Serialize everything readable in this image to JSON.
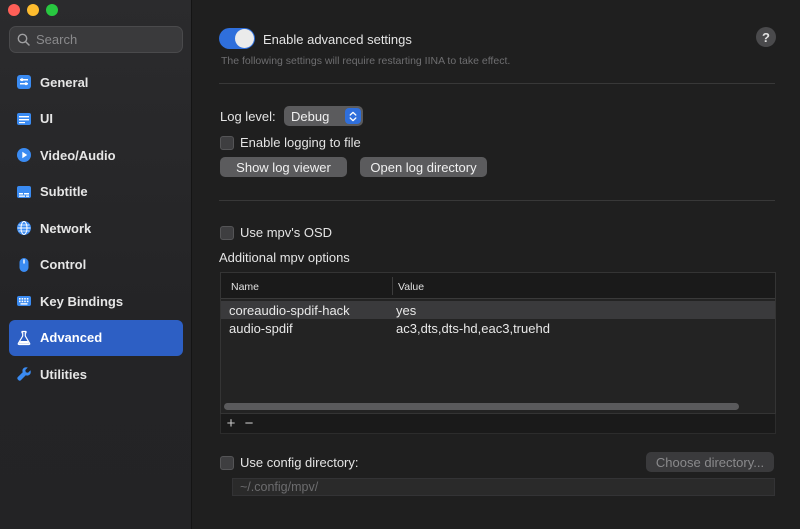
{
  "search": {
    "placeholder": "Search"
  },
  "sidebar": {
    "items": [
      {
        "label": "General",
        "icon": "general-icon"
      },
      {
        "label": "UI",
        "icon": "ui-icon"
      },
      {
        "label": "Video/Audio",
        "icon": "play-icon"
      },
      {
        "label": "Subtitle",
        "icon": "subtitle-icon"
      },
      {
        "label": "Network",
        "icon": "globe-icon"
      },
      {
        "label": "Control",
        "icon": "mouse-icon"
      },
      {
        "label": "Key Bindings",
        "icon": "keyboard-icon"
      },
      {
        "label": "Advanced",
        "icon": "flask-icon",
        "active": true
      },
      {
        "label": "Utilities",
        "icon": "wrench-icon"
      }
    ]
  },
  "advanced": {
    "enable_label": "Enable advanced settings",
    "enabled": true,
    "hint": "The following settings will require restarting IINA to take effect.",
    "help": "?"
  },
  "logging": {
    "level_label": "Log level:",
    "level_value": "Debug",
    "enable_file_label": "Enable logging to file",
    "show_viewer_label": "Show log viewer",
    "open_dir_label": "Open log directory"
  },
  "mpv": {
    "osd_label": "Use mpv's OSD",
    "options_label": "Additional mpv options",
    "columns": [
      "Name",
      "Value"
    ],
    "rows": [
      {
        "name": "coreaudio-spdif-hack",
        "value": "yes"
      },
      {
        "name": "audio-spdif",
        "value": "ac3,dts,dts-hd,eac3,truehd"
      }
    ],
    "add_symbol": "+",
    "remove_symbol": "−"
  },
  "config": {
    "use_dir_label": "Use config directory:",
    "choose_label": "Choose directory...",
    "path_placeholder": "~/.config/mpv/"
  },
  "colors": {
    "accent": "#2f6fdc",
    "sidebar_active": "#2d5fc4",
    "icon_blue": "#3a8bf2"
  }
}
